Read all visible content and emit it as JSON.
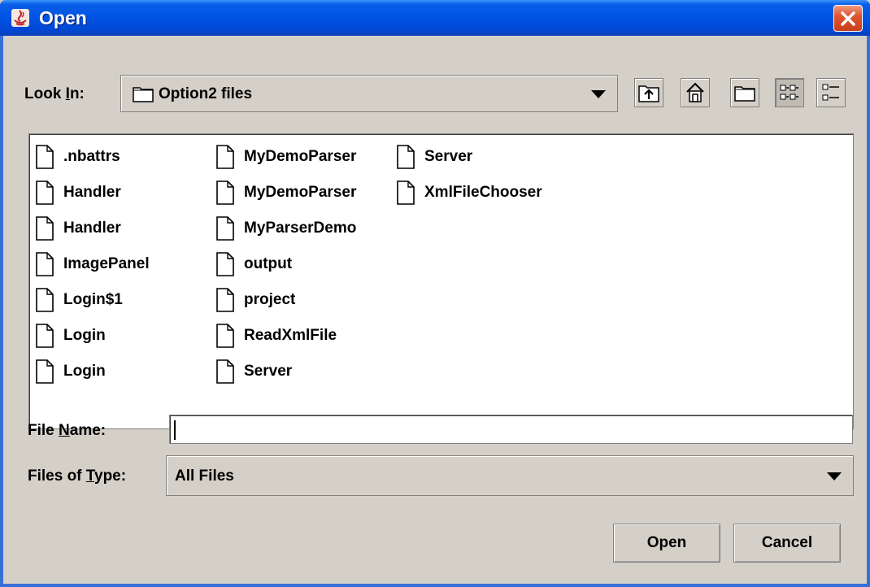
{
  "window": {
    "title": "Open"
  },
  "look_in": {
    "label_pre": "Look ",
    "label_mnemonic": "I",
    "label_post": "n:",
    "value": "Option2 files"
  },
  "toolbar": {
    "up": "up-one-level-icon",
    "home": "home-icon",
    "new_folder": "new-folder-icon",
    "list_view": "list-view-icon",
    "details_view": "details-view-icon",
    "active_view": "list"
  },
  "files": [
    ".nbattrs",
    "Handler",
    "Handler",
    "ImagePanel",
    "Login$1",
    "Login",
    "Login",
    "MyDemoParser",
    "MyDemoParser",
    "MyParserDemo",
    "output",
    "project",
    "ReadXmlFile",
    "Server",
    "Server",
    "XmlFileChooser"
  ],
  "file_name": {
    "label_pre": "File ",
    "label_mnemonic": "N",
    "label_post": "ame:",
    "value": ""
  },
  "file_type": {
    "label_pre": "Files of ",
    "label_mnemonic": "T",
    "label_post": "ype:",
    "value": "All Files"
  },
  "buttons": {
    "open": "Open",
    "cancel": "Cancel"
  },
  "colors": {
    "titlebar": "#0055e5",
    "close": "#e0552f",
    "dialog_bg": "#d4d0c8"
  }
}
